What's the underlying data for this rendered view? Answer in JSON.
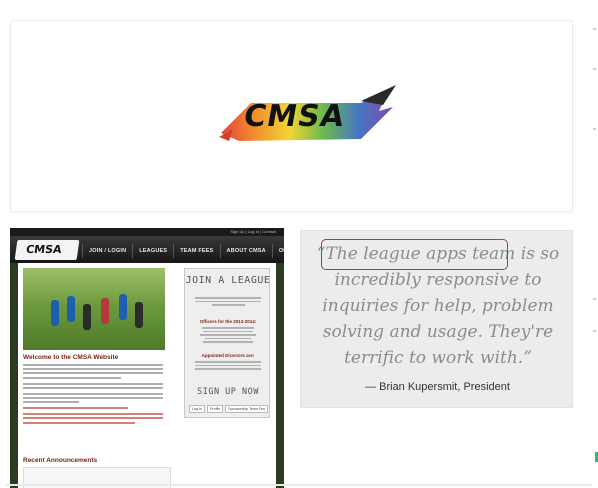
{
  "logo": {
    "text": "CMSA",
    "alt": "CMSA logo"
  },
  "site": {
    "topbar_links": "Sign Up | Log In | Contact",
    "logo_text": "CMSA",
    "nav": [
      "JOIN / LOGIN",
      "LEAGUES",
      "TEAM FEES",
      "ABOUT CMSA",
      "OUR EVENTS"
    ],
    "welcome_title": "Welcome to the CMSA Website",
    "announcements_title": "Recent Announcements",
    "sidebar": {
      "join_title": "JOIN A LEAGUE",
      "officers_title": "Officers for the 2013-2014:",
      "directors_title": "Appointed Directors are:",
      "signup_title": "SIGN UP NOW",
      "buttons": [
        "Log In",
        "Profile",
        "Sponsorship Team Fee"
      ]
    }
  },
  "quote": {
    "text": "“The league apps team is so incredibly responsive to inquiries for help, problem solving and usage. They're terrific to work with.”",
    "attribution": "— Brian Kupersmit, President"
  },
  "colors": {
    "highlight": "#b23a34",
    "quote_text": "#8c8c8c",
    "accent_green": "#2dbb7a"
  }
}
